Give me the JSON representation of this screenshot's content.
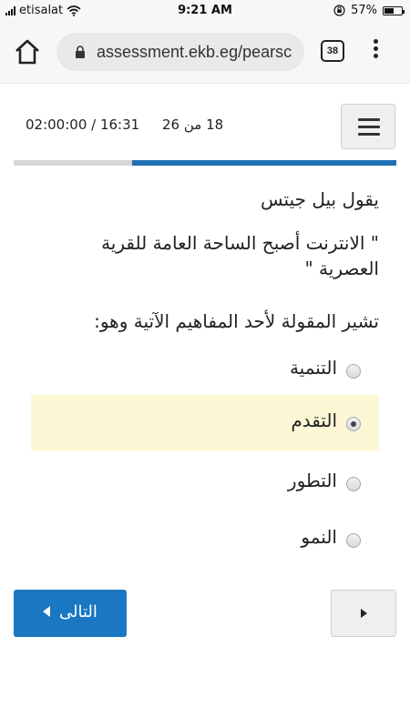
{
  "status_bar": {
    "carrier": "etisalat",
    "time": "9:21 AM",
    "battery_percent": "57%",
    "battery_level": 0.57,
    "icons": [
      "signal-icon",
      "wifi-icon",
      "rotation-lock-icon",
      "battery-icon"
    ]
  },
  "browser": {
    "url": "assessment.ekb.eg/pearsc",
    "tab_count": "38",
    "icons": [
      "home-icon",
      "lock-icon",
      "tabs-icon",
      "more-vert-icon"
    ]
  },
  "quiz": {
    "timer": "02:00:00 / 16:31",
    "page_count": "18 من 26",
    "progress": 0.69,
    "colors": {
      "progress": "#1f6fb3",
      "primary_button": "#1a77c2",
      "selected_row": "#fcf8d6"
    }
  },
  "question": {
    "line1": "يقول بيل جيتس",
    "line2": "\" الانترنت أصبح الساحة العامة للقرية",
    "line3": "العصرية \"",
    "line4": "تشير المقولة لأحد المفاهيم الآتية وهو:"
  },
  "options": [
    {
      "label": "التنمية",
      "selected": false
    },
    {
      "label": "التقدم",
      "selected": true
    },
    {
      "label": "التطور",
      "selected": false
    },
    {
      "label": "النمو",
      "selected": false
    }
  ],
  "nav": {
    "next_label": "التالى"
  }
}
